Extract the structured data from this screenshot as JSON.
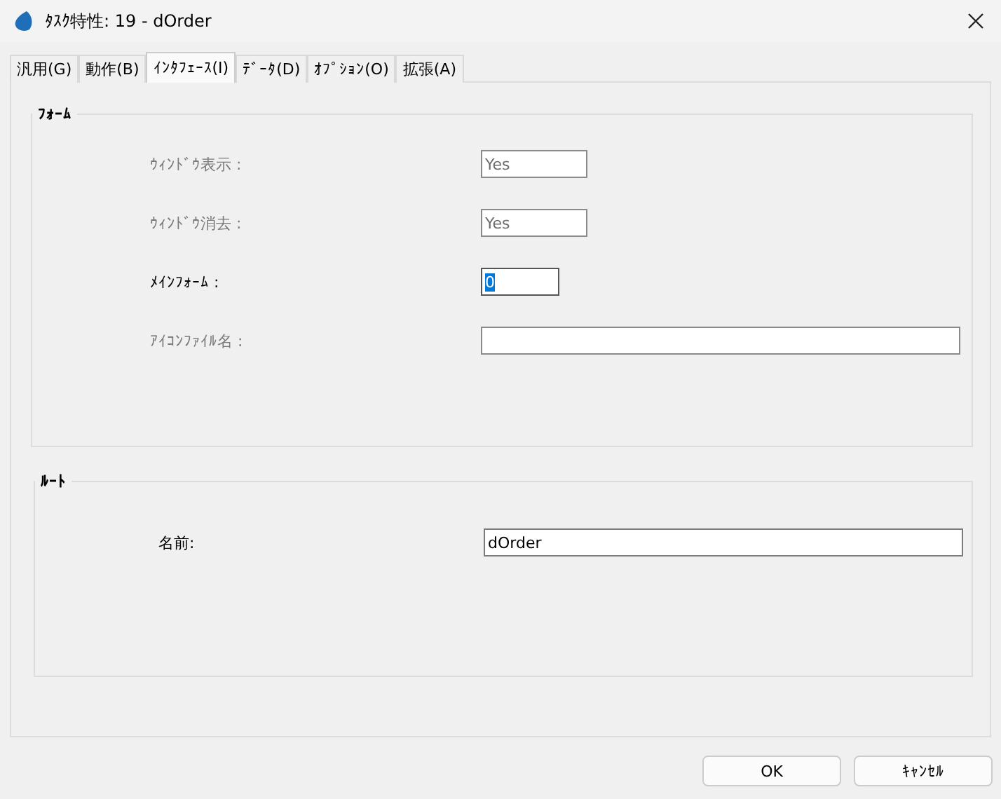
{
  "window": {
    "title": "ﾀｽｸ特性: 19 -   dOrder"
  },
  "tabs": [
    {
      "label": "汎用(G)",
      "selected": false
    },
    {
      "label": "動作(B)",
      "selected": false
    },
    {
      "label": "ｲﾝﾀﾌｪｰｽ(I)",
      "selected": true
    },
    {
      "label": "ﾃﾞｰﾀ(D)",
      "selected": false
    },
    {
      "label": "ｵﾌﾟｼｮﾝ(O)",
      "selected": false
    },
    {
      "label": "拡張(A)",
      "selected": false
    }
  ],
  "groups": [
    {
      "title": "ﾌｫｰﾑ",
      "fields": [
        {
          "label": "ｳｨﾝﾄﾞｳ表示 :",
          "value": "Yes",
          "disabled": true,
          "selected": false
        },
        {
          "label": "ｳｨﾝﾄﾞｳ消去 :",
          "value": "Yes",
          "disabled": true,
          "selected": false
        },
        {
          "label": "ﾒｲﾝﾌｫｰﾑ :",
          "value": "0",
          "disabled": false,
          "selected": true
        },
        {
          "label": "ｱｲｺﾝﾌｧｲﾙ名 :",
          "disabled": true,
          "selected": false
        }
      ]
    },
    {
      "title": "ﾙｰﾄ",
      "fields": [
        {
          "label": "名前:",
          "value": "dOrder",
          "disabled": false,
          "selected": false
        }
      ]
    }
  ],
  "buttons": [
    "OK",
    "ｷｬﾝｾﾙ"
  ]
}
